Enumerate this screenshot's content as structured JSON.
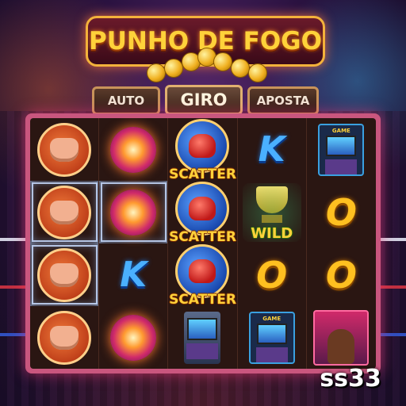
{
  "game": {
    "title": "PUNHO DE FOGO",
    "brand": "ss33"
  },
  "controls": {
    "auto_label": "AUTO",
    "spin_label": "GIRO",
    "bet_label": "APOSTA"
  },
  "reels": {
    "columns": 5,
    "rows": 4,
    "grid": [
      [
        "fist",
        "fire-orb",
        "scatter",
        "K",
        "arcade"
      ],
      [
        "fist",
        "fire-orb",
        "scatter",
        "wild",
        "O"
      ],
      [
        "fist",
        "K",
        "scatter",
        "O",
        "O"
      ],
      [
        "fist",
        "fire-orb",
        "arcade",
        "arcade",
        "boxer"
      ]
    ],
    "lightning_cells": [
      [
        1,
        0
      ],
      [
        1,
        1
      ],
      [
        2,
        0
      ]
    ],
    "labels": {
      "scatter": "SCATTER",
      "wild": "WILD",
      "k": "K",
      "o": "O",
      "arcade_label": "GAME"
    }
  },
  "colors": {
    "title_gold": "#ffd23a",
    "frame_pink": "#c9567e",
    "button_border": "#c8935a"
  }
}
